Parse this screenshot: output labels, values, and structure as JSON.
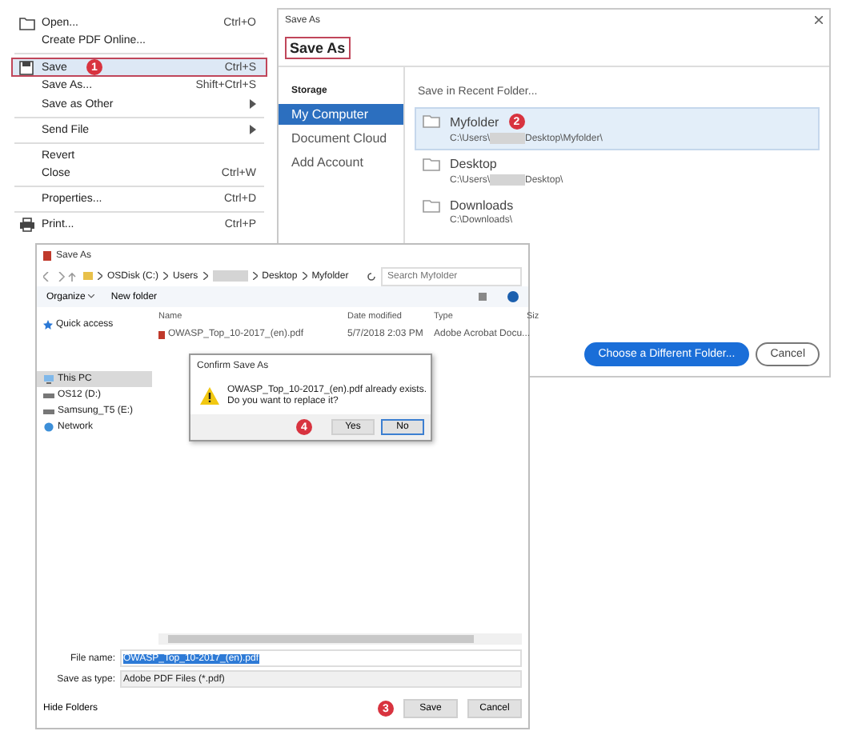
{
  "menu": {
    "items": [
      {
        "kind": "folder",
        "label": "Open...",
        "shortcut": "Ctrl+O",
        "selected": false,
        "submenu": false
      },
      {
        "kind": "plain",
        "label": "Create PDF Online...",
        "selected": false,
        "submenu": false
      },
      {
        "kind": "separator"
      },
      {
        "kind": "disk",
        "label": "Save",
        "shortcut": "Ctrl+S",
        "selected": true,
        "submenu": false,
        "badge": "1"
      },
      {
        "kind": "plain",
        "label": "Save As...",
        "shortcut": "Shift+Ctrl+S",
        "selected": false,
        "submenu": false
      },
      {
        "kind": "plain",
        "label": "Save as Other",
        "selected": false,
        "submenu": true
      },
      {
        "kind": "separator"
      },
      {
        "kind": "plain",
        "label": "Send File",
        "selected": false,
        "submenu": true
      },
      {
        "kind": "separator"
      },
      {
        "kind": "plain",
        "label": "Revert",
        "selected": false,
        "submenu": false
      },
      {
        "kind": "plain",
        "label": "Close",
        "shortcut": "Ctrl+W",
        "selected": false,
        "submenu": false
      },
      {
        "kind": "separator"
      },
      {
        "kind": "plain",
        "label": "Properties...",
        "shortcut": "Ctrl+D",
        "selected": false,
        "submenu": false
      },
      {
        "kind": "separator"
      },
      {
        "kind": "printer",
        "label": "Print...",
        "shortcut": "Ctrl+P",
        "selected": false,
        "submenu": false
      }
    ]
  },
  "adobe_save_as": {
    "title": "Save As",
    "heading": "Save As",
    "storage_heading": "Storage",
    "sidebar": [
      {
        "label": "My Computer",
        "selected": true
      },
      {
        "label": "Document Cloud",
        "selected": false
      },
      {
        "label": "Add Account",
        "selected": false
      }
    ],
    "recent_heading": "Save in Recent Folder...",
    "folders": [
      {
        "name": "Myfolder",
        "path_start": "C:\\Users\\",
        "path_end": "Desktop\\Myfolder\\",
        "redacted": true,
        "selected": true,
        "badge": "2"
      },
      {
        "name": "Desktop",
        "path_start": "C:\\Users\\",
        "path_end": "Desktop\\",
        "redacted": true,
        "selected": false
      },
      {
        "name": "Downloads",
        "path_start": "C:\\Downloads\\",
        "redacted": false,
        "selected": false
      }
    ],
    "buttons": [
      {
        "label": "Choose a Different Folder...",
        "kind": "primary"
      },
      {
        "label": "Cancel",
        "kind": "secondary"
      }
    ]
  },
  "windows_save_as": {
    "title": "Save As",
    "breadcrumbs": [
      {
        "label": "OSDisk (C:)",
        "redacted": false
      },
      {
        "label": "Users",
        "redacted": false
      },
      {
        "redacted": true
      },
      {
        "label": "Desktop",
        "redacted": false
      },
      {
        "label": "Myfolder",
        "redacted": false
      }
    ],
    "search": {
      "placeholder": "Search Myfolder"
    },
    "toolbar": [
      {
        "label": "Organize",
        "dropdown": true
      },
      {
        "label": "New folder",
        "dropdown": false
      }
    ],
    "nav": [
      {
        "kind": "star",
        "label": "Quick access",
        "selected": false
      },
      {
        "kind": "pc",
        "label": "This PC",
        "selected": true
      },
      {
        "kind": "drive",
        "label": "OS12 (D:)",
        "selected": false
      },
      {
        "kind": "drive",
        "label": "Samsung_T5 (E:)",
        "selected": false
      },
      {
        "kind": "network",
        "label": "Network",
        "selected": false
      }
    ],
    "columns": [
      "Name",
      "Date modified",
      "Type",
      "Siz"
    ],
    "files": [
      {
        "name": "OWASP_Top_10-2017_(en).pdf",
        "date": "5/7/2018 2:03 PM",
        "type": "Adobe Acrobat Docu..."
      }
    ],
    "file_name": {
      "label": "File name:",
      "value": "OWASP_Top_10-2017_(en).pdf"
    },
    "save_type": {
      "label": "Save as type:",
      "value": "Adobe PDF Files (*.pdf)"
    },
    "hide_folders": "Hide Folders",
    "buttons": [
      {
        "label": "Save",
        "badge": "3"
      },
      {
        "label": "Cancel"
      }
    ]
  },
  "confirm": {
    "title": "Confirm Save As",
    "message_lines": [
      "OWASP_Top_10-2017_(en).pdf already exists.",
      "Do you want to replace it?"
    ],
    "buttons": [
      {
        "label": "Yes",
        "default": false,
        "badge": "4"
      },
      {
        "label": "No",
        "default": true
      }
    ]
  }
}
